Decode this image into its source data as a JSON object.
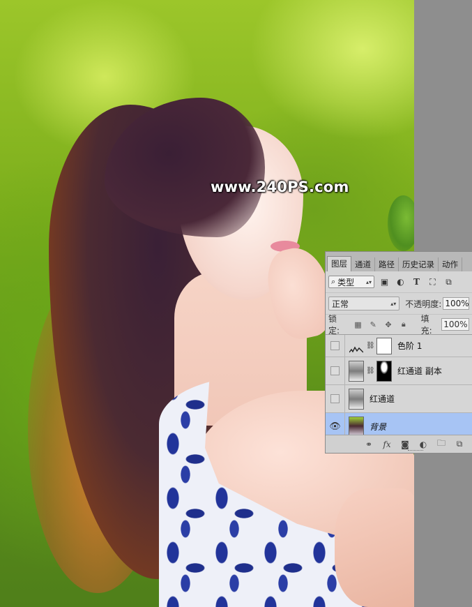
{
  "watermark": "www.240PS.com",
  "panel": {
    "tabs": [
      "图层",
      "通道",
      "路径",
      "历史记录",
      "动作"
    ],
    "active_tab": "图层",
    "filter": {
      "kind_label": "类型",
      "search_glyph": "⌕"
    },
    "blend": {
      "mode": "正常",
      "opacity_label": "不透明度:",
      "opacity_value": "100%"
    },
    "lock": {
      "label": "锁定:",
      "fill_label": "填充:",
      "fill_value": "100%"
    },
    "layers": [
      {
        "name": "色阶 1",
        "visible": false,
        "selected": false,
        "type": "adjustment"
      },
      {
        "name": "红通道 副本",
        "visible": false,
        "selected": false,
        "type": "masked"
      },
      {
        "name": "红通道",
        "visible": false,
        "selected": false,
        "type": "normal"
      },
      {
        "name": "背景",
        "visible": true,
        "selected": true,
        "type": "background"
      }
    ],
    "footer_icons": [
      "link-icon",
      "fx-icon",
      "mask-icon",
      "adjustment-icon",
      "folder-icon",
      "new-layer-icon"
    ]
  },
  "colors": {
    "panel_bg": "#d6d6d6",
    "selected_row": "#a7c4f4",
    "pasteboard": "#8e8e8e"
  }
}
